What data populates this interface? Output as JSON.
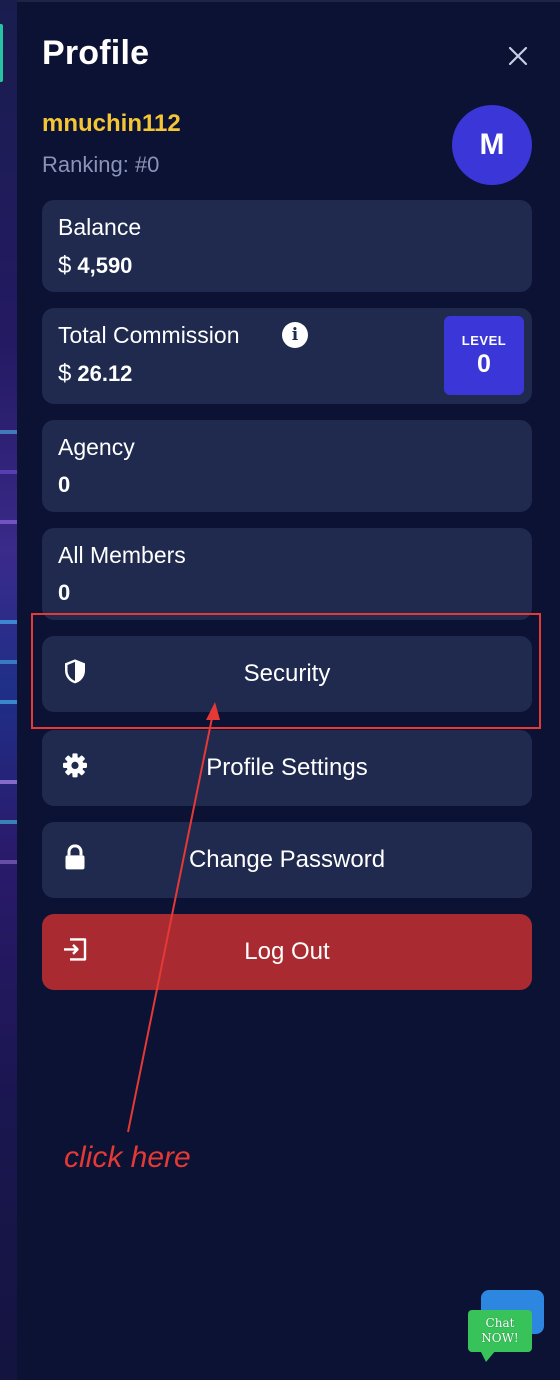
{
  "header": {
    "title": "Profile",
    "close_icon": "close-icon"
  },
  "user": {
    "username": "mnuchin112",
    "ranking": "Ranking: #0",
    "avatar_initial": "M"
  },
  "stats": {
    "balance": {
      "label": "Balance",
      "currency": "$",
      "value": "4,590"
    },
    "commission": {
      "label": "Total Commission",
      "currency": "$",
      "value": "26.12",
      "info_icon": "info-icon"
    },
    "level": {
      "label": "LEVEL",
      "value": "0"
    },
    "agency": {
      "label": "Agency",
      "value": "0"
    },
    "members": {
      "label": "All Members",
      "value": "0"
    }
  },
  "actions": {
    "security": {
      "label": "Security",
      "icon": "shield-icon"
    },
    "profile_settings": {
      "label": "Profile Settings",
      "icon": "gear-icon"
    },
    "change_password": {
      "label": "Change Password",
      "icon": "lock-icon"
    },
    "logout": {
      "label": "Log Out",
      "icon": "logout-icon"
    }
  },
  "annotation": {
    "text": "click here",
    "color": "#e53935"
  },
  "chat": {
    "line1": "Chat",
    "line2": "NOW!"
  },
  "colors": {
    "background": "#0b1233",
    "card": "#1f2a4e",
    "accent": "#3a36d8",
    "username": "#f4c534",
    "logout": "#a92b31"
  }
}
